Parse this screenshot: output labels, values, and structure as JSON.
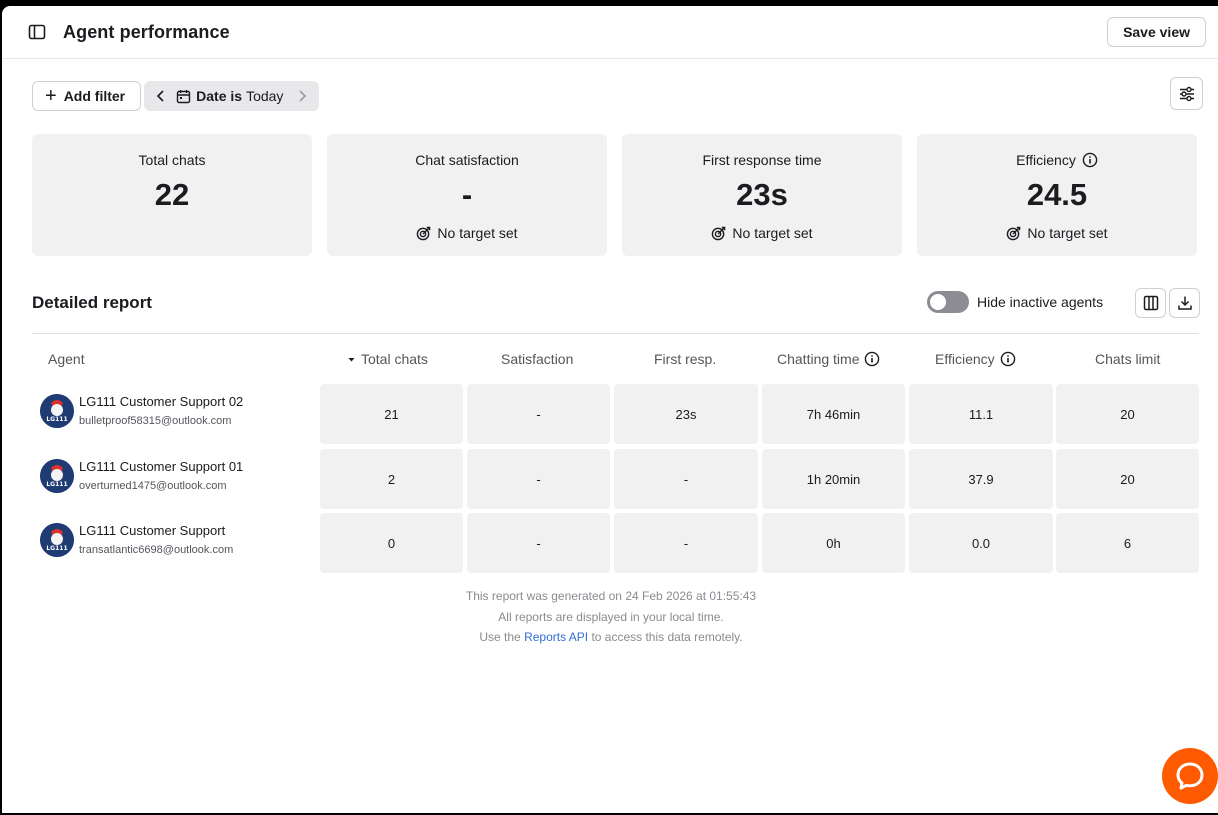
{
  "header": {
    "title": "Agent performance",
    "save_view_label": "Save view"
  },
  "filters": {
    "add_filter_label": "Add filter",
    "date_key": "Date is",
    "date_value": "Today"
  },
  "metrics": [
    {
      "label": "Total chats",
      "value": "22",
      "target": ""
    },
    {
      "label": "Chat satisfaction",
      "value": "-",
      "target": "No target set"
    },
    {
      "label": "First response time",
      "value": "23s",
      "target": "No target set"
    },
    {
      "label": "Efficiency",
      "value": "24.5",
      "target": "No target set"
    }
  ],
  "report": {
    "title": "Detailed report",
    "toggle_label": "Hide inactive agents",
    "toggle_on": false,
    "columns": [
      "Agent",
      "Total chats",
      "Satisfaction",
      "First resp.",
      "Chatting time",
      "Efficiency",
      "Chats limit"
    ],
    "rows": [
      {
        "name": "LG111 Customer Support 02",
        "email": "bulletproof58315@outlook.com",
        "total_chats": "21",
        "satisfaction": "-",
        "first_resp": "23s",
        "chatting_time": "7h 46min",
        "efficiency": "11.1",
        "chats_limit": "20"
      },
      {
        "name": "LG111 Customer Support 01",
        "email": "overturned1475@outlook.com",
        "total_chats": "2",
        "satisfaction": "-",
        "first_resp": "-",
        "chatting_time": "1h 20min",
        "efficiency": "37.9",
        "chats_limit": "20"
      },
      {
        "name": "LG111 Customer Support",
        "email": "transatlantic6698@outlook.com",
        "total_chats": "0",
        "satisfaction": "-",
        "first_resp": "-",
        "chatting_time": "0h",
        "efficiency": "0.0",
        "chats_limit": "6"
      }
    ]
  },
  "footer": {
    "line1": "This report was generated on 24 Feb 2026 at 01:55:43",
    "line2": "All reports are displayed in your local time.",
    "line3_prefix": "Use the",
    "line3_link": "Reports API",
    "line3_suffix": "to access this data remotely."
  },
  "avatar_text": "LG111",
  "colors": {
    "accent": "#ff5a00",
    "link": "#2f6fd6",
    "card_bg": "#f1f1f2"
  },
  "icons": [
    "sidebar-toggle-icon",
    "plus-icon",
    "chevron-left-icon",
    "calendar-icon",
    "chevron-right-icon",
    "sliders-icon",
    "target-icon",
    "info-icon",
    "columns-icon",
    "download-icon",
    "sort-down-icon",
    "chat-bubble-icon"
  ]
}
